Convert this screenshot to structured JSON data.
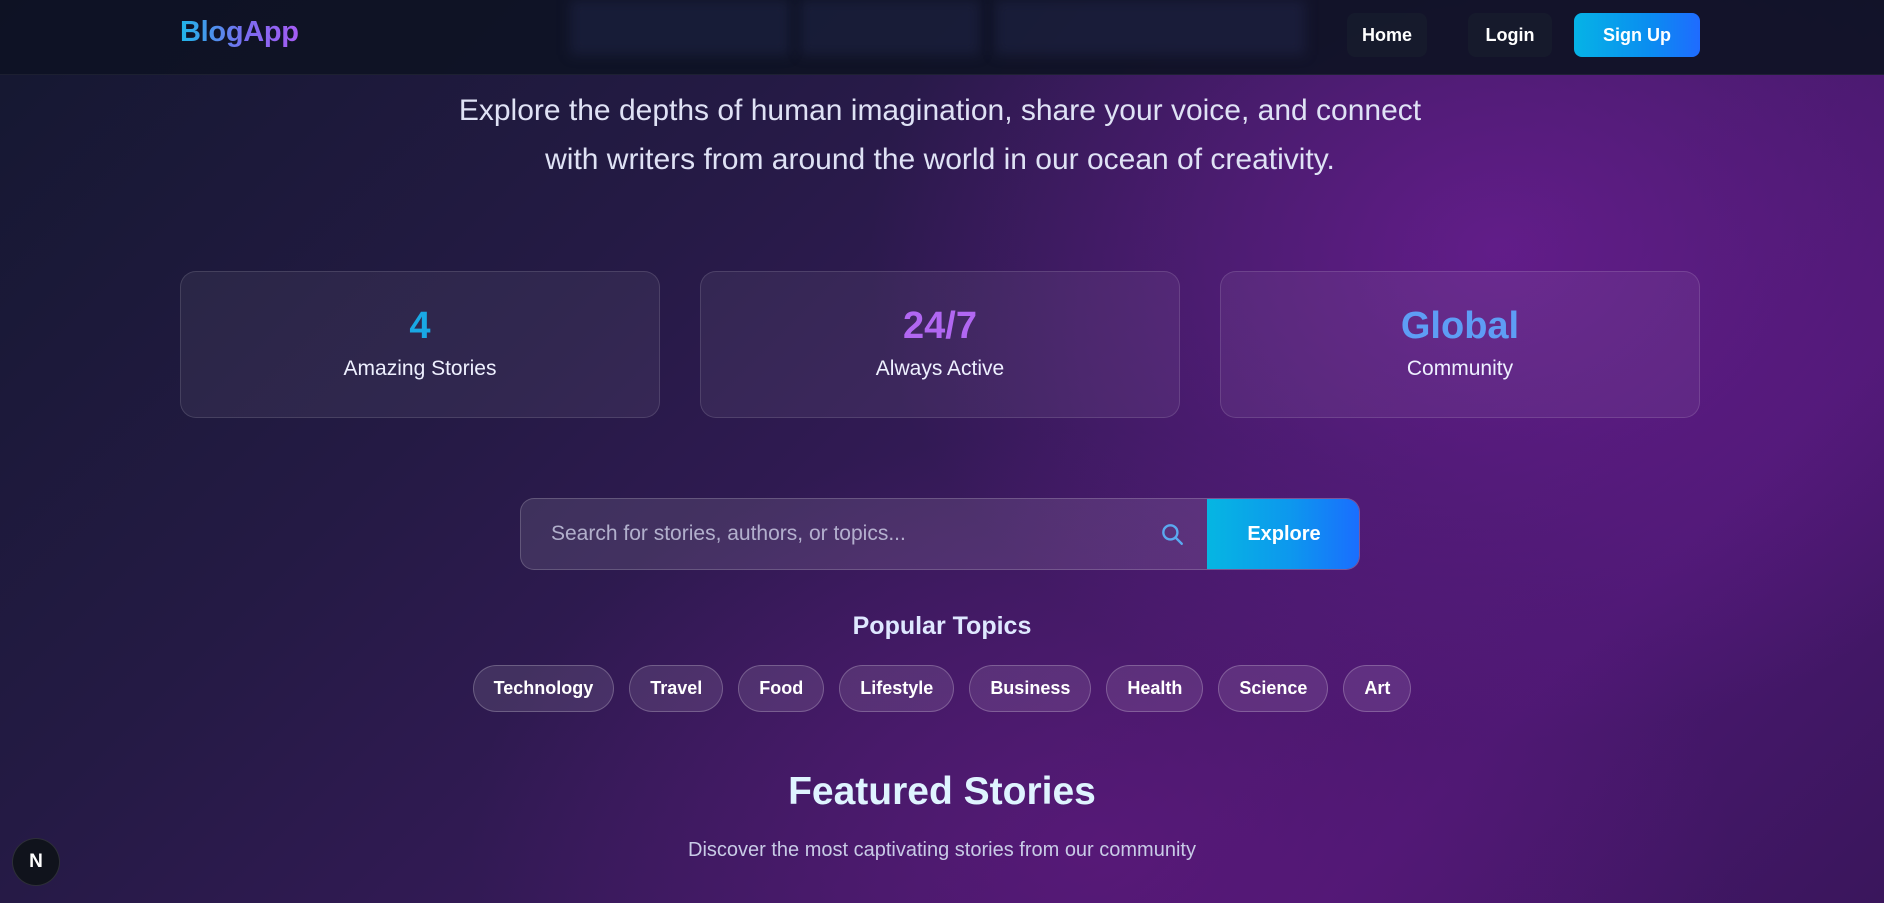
{
  "header": {
    "logo": "BlogApp",
    "nav": {
      "home": "Home",
      "login": "Login",
      "signup": "Sign Up"
    }
  },
  "hero": {
    "description": "Explore the depths of human imagination, share your voice, and connect with writers from around the world in our ocean of creativity."
  },
  "stats": [
    {
      "value": "4",
      "label": "Amazing Stories",
      "color": "#19a8e4"
    },
    {
      "value": "24/7",
      "label": "Always Active",
      "color": "#b167f2"
    },
    {
      "value": "Global",
      "label": "Community",
      "color": "#5e9df5"
    }
  ],
  "search": {
    "placeholder": "Search for stories, authors, or topics...",
    "value": "",
    "button": "Explore",
    "icon": "search-icon"
  },
  "topics": {
    "title": "Popular Topics",
    "items": [
      "Technology",
      "Travel",
      "Food",
      "Lifestyle",
      "Business",
      "Health",
      "Science",
      "Art"
    ]
  },
  "featured": {
    "title": "Featured Stories",
    "subtitle": "Discover the most captivating stories from our community"
  },
  "dev_badge": {
    "label": "N"
  }
}
